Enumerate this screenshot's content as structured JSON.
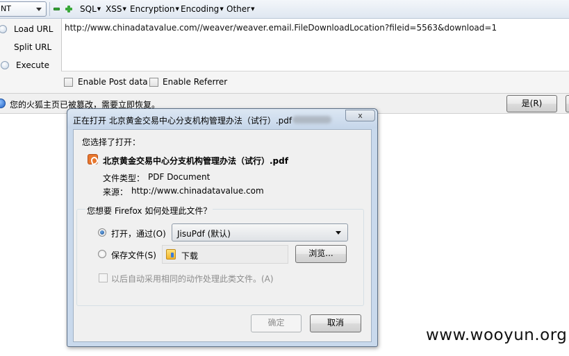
{
  "hackbar": {
    "select_value": "NT",
    "menus": [
      {
        "label": "SQL"
      },
      {
        "label": "XSS"
      },
      {
        "label": "Encryption"
      },
      {
        "label": "Encoding"
      },
      {
        "label": "Other"
      }
    ],
    "actions": {
      "load_url": "Load URL",
      "split_url": "Split URL",
      "execute": "Execute"
    },
    "url_value": "http://www.chinadatavalue.com//weaver/weaver.email.FileDownloadLocation?fileid=5563&download=1",
    "options": {
      "enable_post": "Enable Post data",
      "enable_referrer": "Enable Referrer"
    }
  },
  "notification": {
    "message": "您的火狐主页已被篡改，需要立即恢复。",
    "yes_button": "是(R)"
  },
  "dialog": {
    "title": "正在打开 北京黄金交易中心分支机构管理办法（试行）.pdf",
    "close_label": "x",
    "chosen_label": "您选择了打开：",
    "file_name": "北京黄金交易中心分支机构管理办法（试行）.pdf",
    "file_type_label": "文件类型：",
    "file_type_value": "PDF Document",
    "source_label": "来源：",
    "source_value": "http://www.chinadatavalue.com",
    "question": "您想要 Firefox 如何处理此文件？",
    "open_with_label": "打开，通过(O)",
    "open_with_app": "JisuPdf (默认)",
    "save_file_label": "保存文件(S)",
    "save_folder": "下载",
    "browse_button": "浏览...",
    "auto_label": "以后自动采用相同的动作处理此类文件。(A)",
    "ok_button": "确定",
    "cancel_button": "取消"
  },
  "watermark": "www.wooyun.org"
}
